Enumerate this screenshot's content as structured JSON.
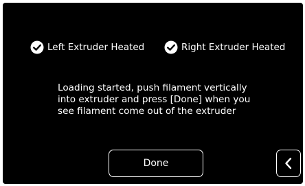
{
  "status": {
    "left_label": "Left Extruder Heated",
    "right_label": "Right Extruder Heated",
    "icon": "check-circle-icon"
  },
  "message": {
    "text": "Loading started, push filament vertically\ninto extruder and press [Done] when you\nsee filament come out of the extruder"
  },
  "buttons": {
    "done_label": "Done",
    "back_icon": "chevron-left-icon"
  },
  "colors": {
    "background": "#000000",
    "foreground": "#ffffff"
  }
}
